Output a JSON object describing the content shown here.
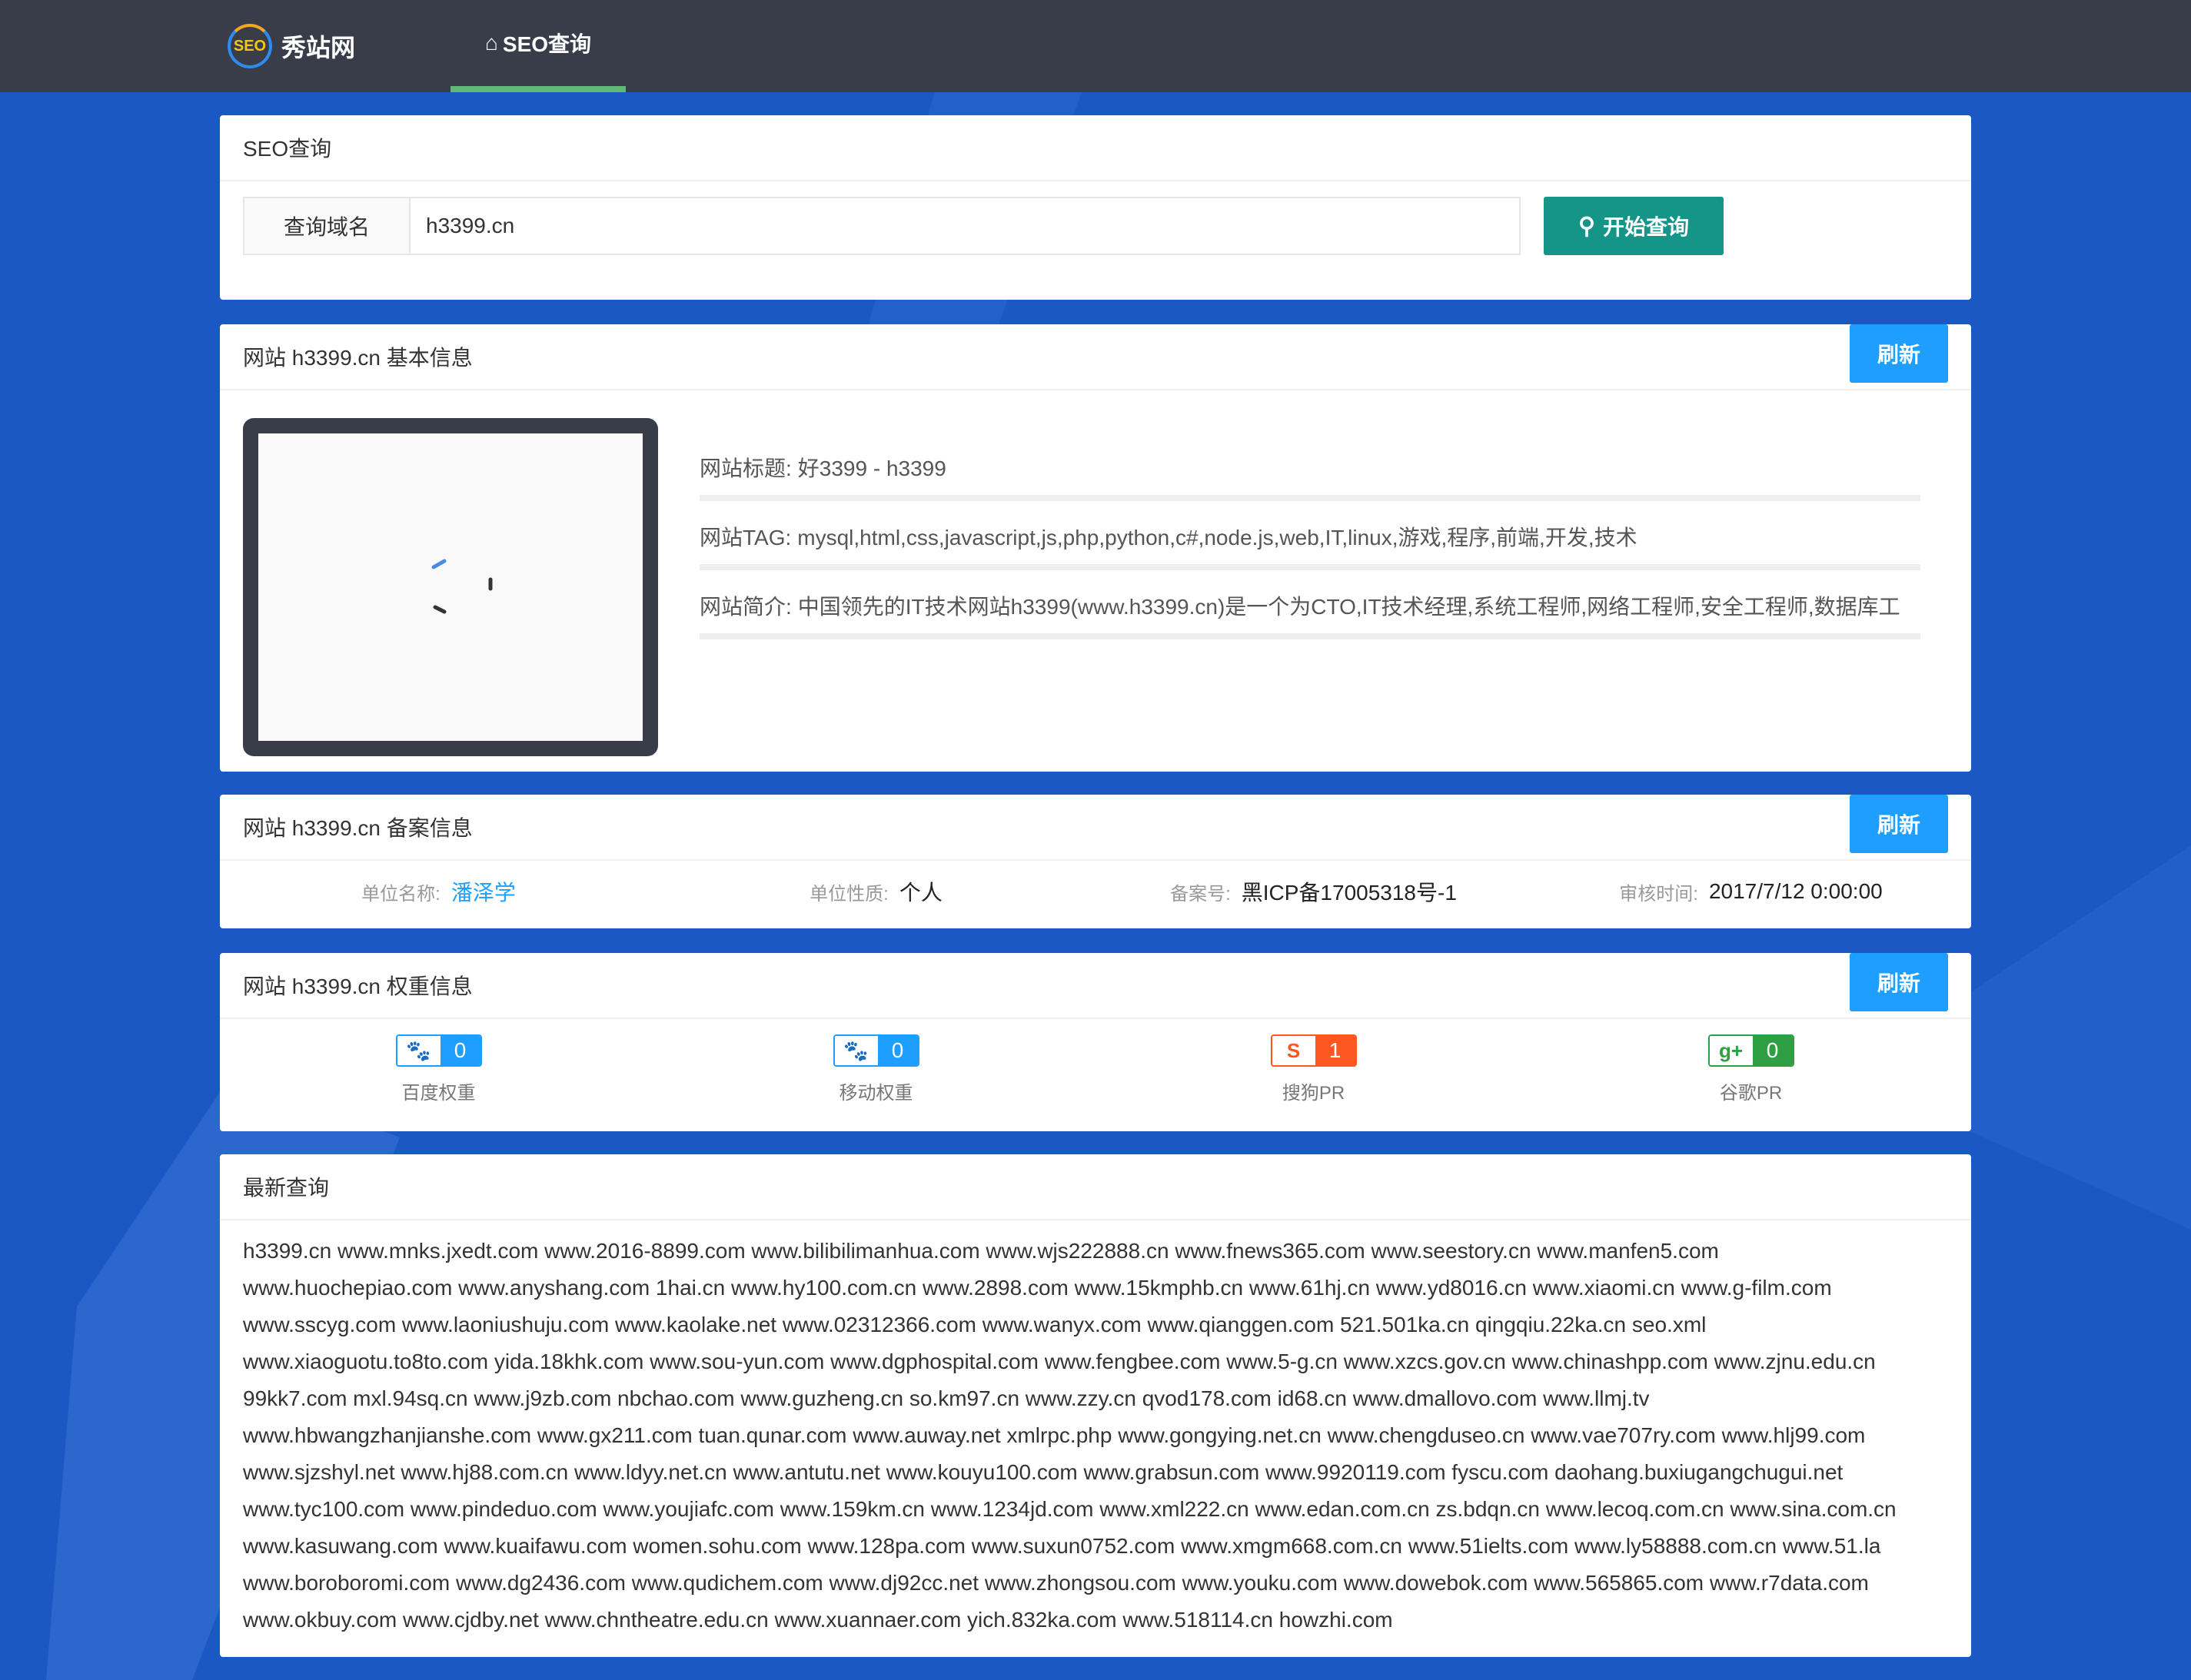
{
  "header": {
    "logo_badge": "SEO",
    "logo_text": "秀站网",
    "nav_label": "SEO查询"
  },
  "search": {
    "panel_title": "SEO查询",
    "label": "查询域名",
    "value": "h3399.cn",
    "button_label": "开始查询"
  },
  "basic": {
    "title": "网站 h3399.cn 基本信息",
    "refresh": "刷新",
    "site_title_key": "网站标题:",
    "site_title": "好3399 - h3399",
    "tag_key": "网站TAG:",
    "tag": "mysql,html,css,javascript,js,php,python,c#,node.js,web,IT,linux,游戏,程序,前端,开发,技术",
    "desc_key": "网站简介:",
    "desc": "中国领先的IT技术网站h3399(www.h3399.cn)是一个为CTO,IT技术经理,系统工程师,网络工程师,安全工程师,数据库工"
  },
  "icp": {
    "title": "网站 h3399.cn 备案信息",
    "refresh": "刷新",
    "org_key": "单位名称:",
    "org": "潘泽学",
    "type_key": "单位性质:",
    "type": "个人",
    "no_key": "备案号:",
    "no": "黑ICP备17005318号-1",
    "time_key": "审核时间:",
    "time": "2017/7/12 0:00:00"
  },
  "weight": {
    "title": "网站 h3399.cn 权重信息",
    "refresh": "刷新",
    "items": [
      {
        "label": "百度权重",
        "value": "0",
        "icon": "paw-icon",
        "color": "#1e9fff",
        "glyph": "🐾"
      },
      {
        "label": "移动权重",
        "value": "0",
        "icon": "paw-icon",
        "color": "#1e9fff",
        "glyph": "🐾"
      },
      {
        "label": "搜狗PR",
        "value": "1",
        "icon": "sogou-icon",
        "color": "#ff5722",
        "glyph": "S"
      },
      {
        "label": "谷歌PR",
        "value": "0",
        "icon": "google-plus-icon",
        "color": "#2ea043",
        "glyph": "g+"
      }
    ]
  },
  "latest": {
    "title": "最新查询",
    "lines": [
      "h3399.cn www.mnks.jxedt.com www.2016-8899.com www.bilibilimanhua.com www.wjs222888.cn www.fnews365.com www.seestory.cn www.manfen5.com",
      "www.huochepiao.com www.anyshang.com 1hai.cn www.hy100.com.cn www.2898.com www.15kmphb.cn www.61hj.cn www.yd8016.cn www.xiaomi.cn www.g-film.com",
      "www.sscyg.com www.laoniushuju.com www.kaolake.net www.02312366.com www.wanyx.com www.qianggen.com 521.501ka.cn qingqiu.22ka.cn seo.xml",
      "www.xiaoguotu.to8to.com yida.18khk.com www.sou-yun.com www.dgphospital.com www.fengbee.com www.5-g.cn www.xzcs.gov.cn www.chinashpp.com www.zjnu.edu.cn",
      "99kk7.com mxl.94sq.cn www.j9zb.com nbchao.com www.guzheng.cn so.km97.cn www.zzy.cn qvod178.com id68.cn www.dmallovo.com www.llmj.tv",
      "www.hbwangzhanjianshe.com www.gx211.com tuan.qunar.com www.auway.net xmlrpc.php www.gongying.net.cn www.chengduseo.cn www.vae707ry.com www.hlj99.com",
      "www.sjzshyl.net www.hj88.com.cn www.ldyy.net.cn www.antutu.net www.kouyu100.com www.grabsun.com www.9920119.com fyscu.com daohang.buxiugangchugui.net",
      "www.tyc100.com www.pindeduo.com www.youjiafc.com www.159km.cn www.1234jd.com www.xml222.cn www.edan.com.cn zs.bdqn.cn www.lecoq.com.cn www.sina.com.cn",
      "www.kasuwang.com www.kuaifawu.com women.sohu.com www.128pa.com www.suxun0752.com www.xmgm668.com.cn www.51ielts.com www.ly58888.com.cn www.51.la",
      "www.boroboromi.com www.dg2436.com www.qudichem.com www.dj92cc.net www.zhongsou.com www.youku.com www.dowebok.com www.565865.com www.r7data.com",
      "www.okbuy.com www.cjdby.net www.chntheatre.edu.cn www.xuannaer.com yich.832ka.com www.518114.cn howzhi.com"
    ]
  }
}
